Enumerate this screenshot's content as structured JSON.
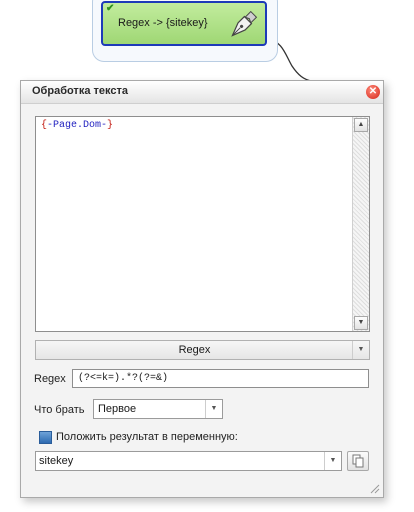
{
  "node": {
    "label": "Regex -> {sitekey}",
    "check_icon": "check-icon",
    "pen_icon": "pen-nib-icon",
    "status_color": "#2d8f1d"
  },
  "dialog": {
    "title": "Обработка текста",
    "close_icon": "close-icon",
    "editor": {
      "open_brace": "{",
      "var_text": "-Page.Dom-",
      "close_brace": "}"
    },
    "mode_select": {
      "value": "Regex"
    },
    "regex": {
      "label": "Regex",
      "value": "(?<=k=).*?(?=&)"
    },
    "take": {
      "label": "Что брать",
      "value": "Первое"
    },
    "save_to_var": {
      "label": "Положить результат в переменную:",
      "checked": true
    },
    "variable": {
      "value": "sitekey"
    }
  },
  "colors": {
    "node_border": "#1d3ab8",
    "node_fill": "#b4e38c",
    "brace": "#c2170f",
    "var": "#1f1fbf",
    "close": "#d42418"
  }
}
